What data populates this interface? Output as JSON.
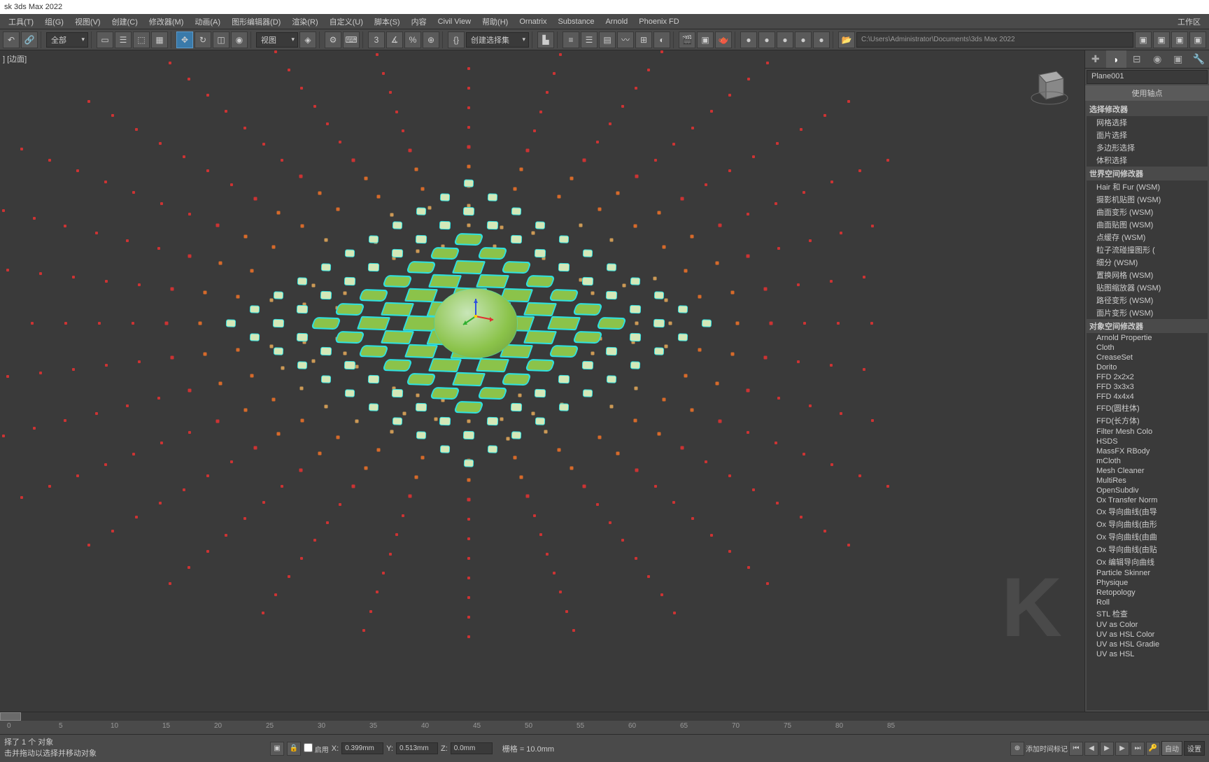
{
  "title": "sk 3ds Max 2022",
  "menu": [
    "工具(T)",
    "组(G)",
    "视图(V)",
    "创建(C)",
    "修改器(M)",
    "动画(A)",
    "图形编辑器(D)",
    "渲染(R)",
    "自定义(U)",
    "脚本(S)",
    "内容",
    "Civil View",
    "帮助(H)",
    "Ornatrix",
    "Substance",
    "Arnold",
    "Phoenix FD"
  ],
  "workspace_label": "工作区",
  "toolbar": {
    "filter_label": "全部",
    "view_label": "视图",
    "selset_label": "创建选择集",
    "path": "C:\\Users\\Administrator\\Documents\\3ds Max 2022"
  },
  "viewport": {
    "label": "] [边面]",
    "obj_name": "Plane001"
  },
  "panel": {
    "pivot_section": "使用轴点",
    "groups": [
      {
        "title": "选择修改器",
        "items": [
          "网格选择",
          "面片选择",
          "多边形选择",
          "体积选择"
        ]
      },
      {
        "title": "世界空间修改器",
        "items": [
          "Hair 和 Fur (WSM)",
          "摄影机贴图 (WSM)",
          "曲面变形 (WSM)",
          "曲面贴图 (WSM)",
          "点缓存 (WSM)",
          "粒子流碰撞图形 (",
          "细分 (WSM)",
          "置换网格 (WSM)",
          "贴图缩放器 (WSM)",
          "路径变形 (WSM)",
          "面片变形 (WSM)"
        ]
      },
      {
        "title": "对象空间修改器",
        "items": [
          "Arnold Propertie",
          "Cloth",
          "CreaseSet",
          "Dorito",
          "FFD 2x2x2",
          "FFD 3x3x3",
          "FFD 4x4x4",
          "FFD(圆柱体)",
          "FFD(长方体)",
          "Filter Mesh Colo",
          "HSDS",
          "MassFX RBody",
          "mCloth",
          "Mesh Cleaner",
          "MultiRes",
          "OpenSubdiv",
          "Ox Transfer Norm",
          "Ox 导向曲线(由导",
          "Ox 导向曲线(由形",
          "Ox 导向曲线(由曲",
          "Ox 导向曲线(由贴",
          "Ox 编辑导向曲线",
          "Particle Skinner",
          "Physique",
          "Retopology",
          "Roll",
          "STL 检查",
          "UV as Color",
          "UV as HSL Color",
          "UV as HSL Gradie",
          "UV as HSL"
        ]
      }
    ]
  },
  "status": {
    "sel_msg": "择了 1 个 对象",
    "hint_msg": "击并拖动以选择并移动对象",
    "enable_label": "启用",
    "x_label": "X:",
    "x_val": "0.399mm",
    "y_label": "Y:",
    "y_val": "0.513mm",
    "z_label": "Z:",
    "z_val": "0.0mm",
    "grid_label": "栅格 = 10.0mm",
    "addtime_label": "添加时间标记",
    "auto_label": "自动",
    "setkey_label": "设置"
  },
  "timeline": {
    "ticks": [
      "0",
      "5",
      "10",
      "15",
      "20",
      "25",
      "30",
      "35",
      "40",
      "45",
      "50",
      "55",
      "60",
      "65",
      "70",
      "75",
      "80",
      "85"
    ]
  }
}
